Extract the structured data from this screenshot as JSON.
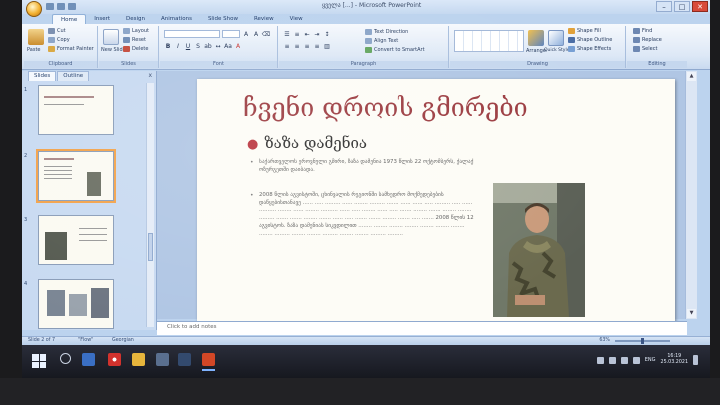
{
  "window": {
    "title": "Microsoft PowerPoint",
    "doc_title": "ყველა [...]",
    "controls": [
      "–",
      "□",
      "✕"
    ]
  },
  "tabs": [
    "Home",
    "Insert",
    "Design",
    "Animations",
    "Slide Show",
    "Review",
    "View"
  ],
  "ribbon": {
    "clipboard": {
      "label": "Clipboard",
      "paste": "Paste",
      "cut": "Cut",
      "copy": "Copy",
      "format_painter": "Format Painter"
    },
    "slides": {
      "label": "Slides",
      "new_slide": "New Slide",
      "layout": "Layout",
      "reset": "Reset",
      "delete": "Delete"
    },
    "font": {
      "label": "Font",
      "font_name": "",
      "font_size": ""
    },
    "paragraph": {
      "label": "Paragraph",
      "text_direction": "Text Direction",
      "align_text": "Align Text",
      "smartart": "Convert to SmartArt"
    },
    "drawing": {
      "label": "Drawing",
      "arrange": "Arrange",
      "quick_styles": "Quick Styles",
      "shape_fill": "Shape Fill",
      "shape_outline": "Shape Outline",
      "shape_effects": "Shape Effects"
    },
    "editing": {
      "label": "Editing",
      "find": "Find",
      "replace": "Replace",
      "select": "Select"
    }
  },
  "left_pane": {
    "tabs": [
      "Slides",
      "Outline"
    ],
    "close": "x",
    "slide_numbers": [
      "1",
      "2",
      "3",
      "4"
    ]
  },
  "slide": {
    "title": "ჩვენი დროის გმირები",
    "bullet": "ზაზა დამენია",
    "para1": "საქართველოს ეროვნული გმირი, ზაზა დამენია 1973 წლის 22 ოქტომბერს, ქალაქ ოზურგეთში დაიბადა.",
    "para2": "2008 წლის აგვისტოში, ცხინვალის რეგიონში სამხედრო მოქმედებების დაწყებისთანავე ...... ..... ......... ...... ........ ......... ....... ...... ...... ..... ......... ..... ...... .......... ........ ...... ........ .......... ...... ..... ........ ...... ..... ....... ........ ....... ........ ........ ......... ....... ....... ........ ....... ...... ..... ....... ....... ........ ....... ..... ....... 2008 წლის 12 აგვისტოს. ზაზა დამენიას სიკვდილით ........ ........ ........ ........ ........ ........ ........ ........ ......... ........ ........ ......... ........ ........ ......... ........."
  },
  "notes": {
    "placeholder": "Click to add notes"
  },
  "status": {
    "slide": "Slide 2 of 7",
    "theme": "\"Flow\"",
    "language": "Georgian",
    "zoom": "63%"
  },
  "taskbar": {
    "language": "ENG",
    "time": "16:19",
    "date": "25.03.2021"
  }
}
